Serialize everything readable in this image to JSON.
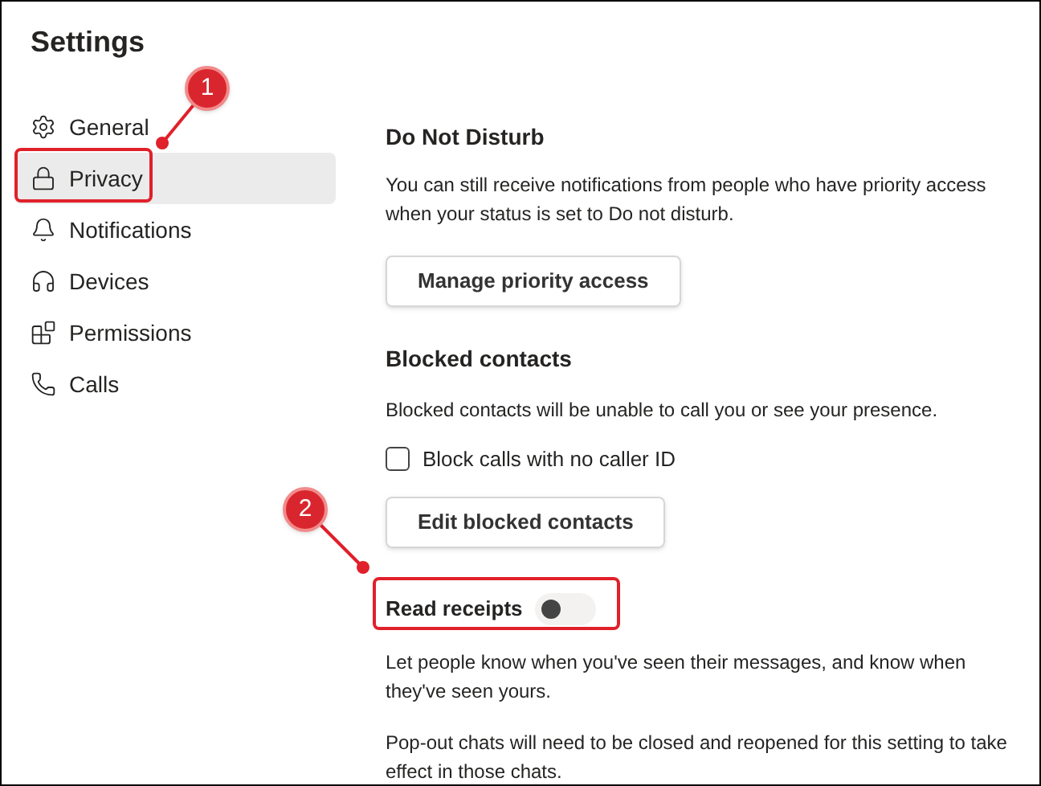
{
  "window": {
    "title": "Settings"
  },
  "sidebar": {
    "items": [
      {
        "label": "General",
        "selected": false
      },
      {
        "label": "Privacy",
        "selected": true
      },
      {
        "label": "Notifications",
        "selected": false
      },
      {
        "label": "Devices",
        "selected": false
      },
      {
        "label": "Permissions",
        "selected": false
      },
      {
        "label": "Calls",
        "selected": false
      }
    ]
  },
  "do_not_disturb": {
    "heading": "Do Not Disturb",
    "description": "You can still receive notifications from people who have priority access when your status is set to Do not disturb.",
    "button": "Manage priority access"
  },
  "blocked_contacts": {
    "heading": "Blocked contacts",
    "description": "Blocked contacts will be unable to call you or see your presence.",
    "checkbox": {
      "label": "Block calls with no caller ID",
      "checked": false
    },
    "button": "Edit blocked contacts"
  },
  "read_receipts": {
    "label": "Read receipts",
    "on": false,
    "descriptions": [
      "Let people know when you've seen their messages, and know when they've seen yours.",
      "Pop-out chats will need to be closed and reopened for this setting to take effect in those chats."
    ]
  },
  "annotations": [
    {
      "number": "1"
    },
    {
      "number": "2"
    }
  ]
}
